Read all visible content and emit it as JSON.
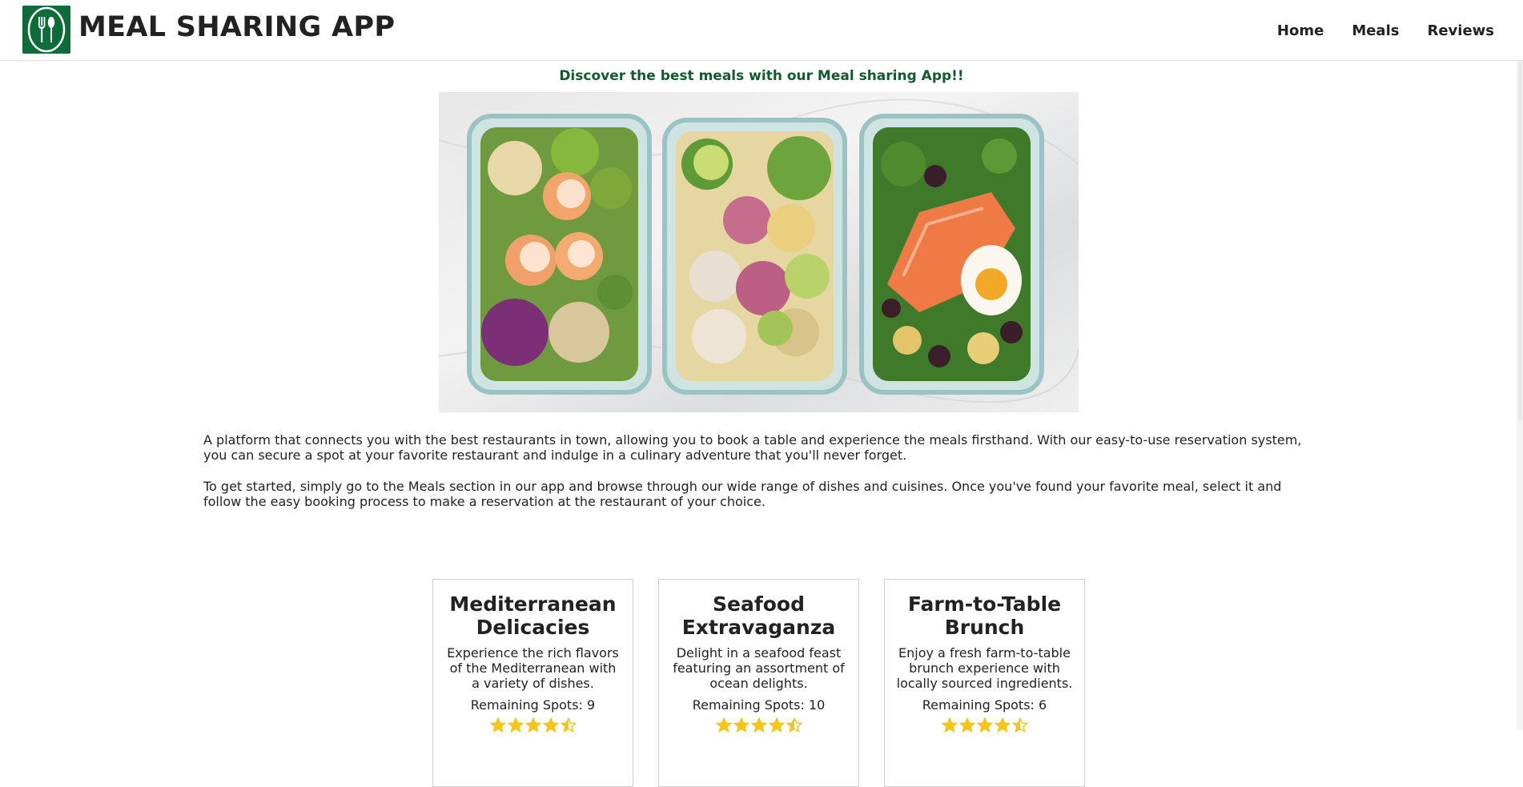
{
  "header": {
    "brand": "MEAL SHARING APP",
    "logo_icon": "fork-spoon-icon",
    "brand_color": "#0e6b3a",
    "nav": [
      {
        "label": "Home"
      },
      {
        "label": "Meals"
      },
      {
        "label": "Reviews"
      }
    ]
  },
  "tagline": "Discover the best meals with our Meal sharing App!!",
  "hero": {
    "image_alt": "meal-prep-containers-image"
  },
  "intro": {
    "paragraph_1": "A platform that connects you with the best restaurants in town, allowing you to book a table and experience the meals firsthand. With our easy-to-use reservation system, you can secure a spot at your favorite restaurant and indulge in a culinary adventure that you'll never forget.",
    "paragraph_2": "To get started, simply go to the Meals section in our app and browse through our wide range of dishes and cuisines. Once you've found your favorite meal, select it and follow the easy booking process to make a reservation at the restaurant of your choice."
  },
  "meals": [
    {
      "title": "Mediterranean Delicacies",
      "description": "Experience the rich flavors of the Mediterranean with a variety of dishes.",
      "spots": "Remaining Spots: 9",
      "rating": 4.5
    },
    {
      "title": "Seafood Extravaganza",
      "description": "Delight in a seafood feast featuring an assortment of ocean delights.",
      "spots": "Remaining Spots: 10",
      "rating": 4.5
    },
    {
      "title": "Farm-to-Table Brunch",
      "description": "Enjoy a fresh farm-to-table brunch experience with locally sourced ingredients.",
      "spots": "Remaining Spots: 6",
      "rating": 4.5
    }
  ],
  "colors": {
    "tagline": "#14592f",
    "star": "#f5c518"
  }
}
